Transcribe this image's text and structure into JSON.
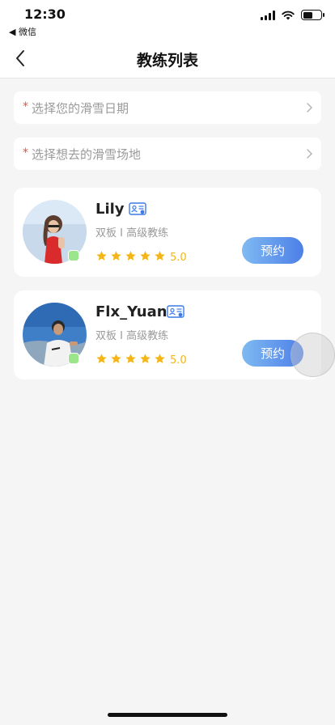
{
  "status_bar": {
    "time": "12:30",
    "back_app": "◀ 微信",
    "icons": [
      "signal-icon",
      "wifi-icon",
      "battery-icon"
    ]
  },
  "nav": {
    "title": "教练列表",
    "back_icon": "chevron-left-icon"
  },
  "filters": {
    "required_mark": "*",
    "date_placeholder": "选择您的滑雪日期",
    "venue_placeholder": "选择想去的滑雪场地"
  },
  "colors": {
    "accent_gradient": [
      "#7fbaf2",
      "#4d7fe8"
    ],
    "star": "#f3b518",
    "required": "#e5533d",
    "online": "#9be68a",
    "badge": "#3d7ae6"
  },
  "coaches": [
    {
      "name": "Lily",
      "meta": "双板 I 高级教练",
      "rating": "5.0",
      "stars": 5,
      "book_label": "预约"
    },
    {
      "name": "Flx_Yuan",
      "meta": "双板 I 高级教练",
      "rating": "5.0",
      "stars": 5,
      "book_label": "预约"
    }
  ]
}
